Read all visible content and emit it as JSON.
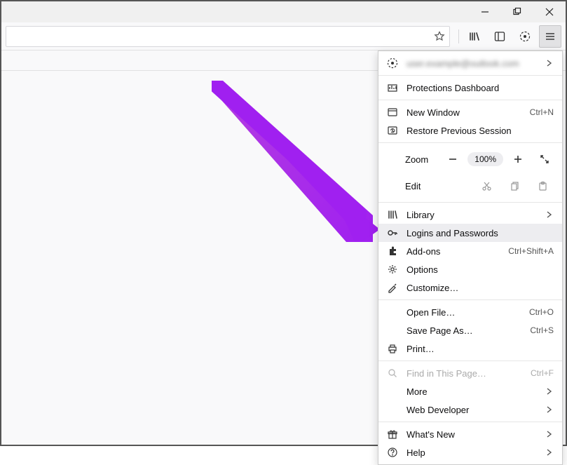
{
  "account_email": "user.example@outlook.com",
  "menu": {
    "protections": "Protections Dashboard",
    "new_window": {
      "label": "New Window",
      "shortcut": "Ctrl+N"
    },
    "restore_session": "Restore Previous Session",
    "zoom": {
      "label": "Zoom",
      "value": "100%"
    },
    "edit": {
      "label": "Edit"
    },
    "library": "Library",
    "logins": "Logins and Passwords",
    "addons": {
      "label": "Add-ons",
      "shortcut": "Ctrl+Shift+A"
    },
    "options": "Options",
    "customize": "Customize…",
    "open_file": {
      "label": "Open File…",
      "shortcut": "Ctrl+O"
    },
    "save_page": {
      "label": "Save Page As…",
      "shortcut": "Ctrl+S"
    },
    "print": "Print…",
    "find": {
      "label": "Find in This Page…",
      "shortcut": "Ctrl+F"
    },
    "more": "More",
    "web_developer": "Web Developer",
    "whats_new": "What's New",
    "help": "Help"
  }
}
